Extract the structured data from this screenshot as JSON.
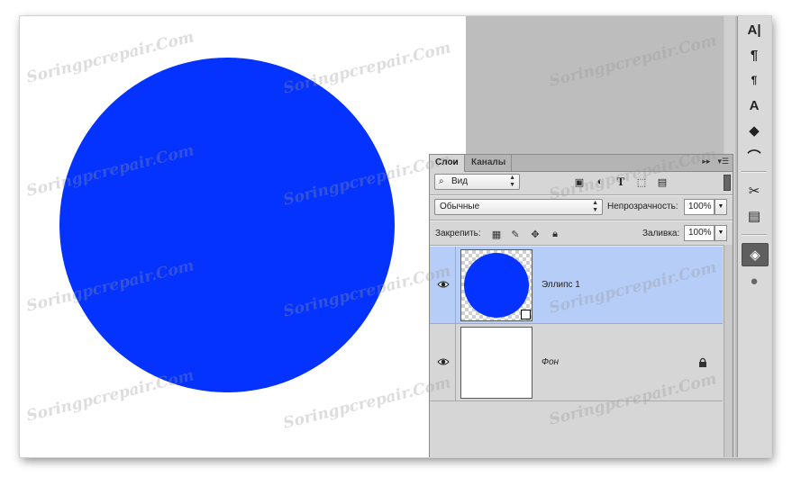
{
  "colors": {
    "ellipse_fill": "#0433ff",
    "canvas_bg": "#ffffff",
    "workspace_bg": "#bdbdbd",
    "panel_bg": "#d6d6d6",
    "selected_row": "#b6cdf7"
  },
  "layers_panel": {
    "tabs": [
      {
        "label": "Слои",
        "active": true
      },
      {
        "label": "Каналы",
        "active": false
      }
    ],
    "menu_icons": [
      "expand-icon",
      "panel-menu-icon"
    ],
    "filter": {
      "kind_label": "Вид",
      "icons": [
        "image-filter-icon",
        "adjustment-filter-icon",
        "type-filter-icon",
        "shape-filter-icon",
        "smart-object-filter-icon"
      ],
      "type_glyph": "T"
    },
    "blend_mode": "Обычные",
    "opacity": {
      "label": "Непрозрачность:",
      "value": "100%"
    },
    "lock": {
      "label": "Закрепить:",
      "icons": [
        "lock-transparent-pixels-icon",
        "lock-image-pixels-icon",
        "lock-position-icon",
        "lock-all-icon"
      ]
    },
    "fill": {
      "label": "Заливка:",
      "value": "100%"
    },
    "layers": [
      {
        "name": "Эллипс 1",
        "selected": true,
        "visible": true,
        "type": "shape",
        "locked": false
      },
      {
        "name": "Фон",
        "selected": false,
        "visible": true,
        "type": "background",
        "locked": true
      }
    ]
  },
  "right_toolbar": {
    "icons": [
      "character-icon",
      "paragraph-icon",
      "paragraph-styles-icon",
      "character-styles-icon",
      "3d-icon",
      "path-icon",
      "tools-icon",
      "properties-icon",
      "layers-icon",
      "channels-icon"
    ],
    "glyphs": {
      "character": "A|",
      "paragraph": "¶",
      "paragraph_styles": "¶",
      "character_styles": "A",
      "three_d": "◆",
      "path": "⌒",
      "tools": "✂",
      "properties": "▤",
      "layers": "◈",
      "channels": "●"
    }
  },
  "watermark": "Soringpcrepair.Com"
}
